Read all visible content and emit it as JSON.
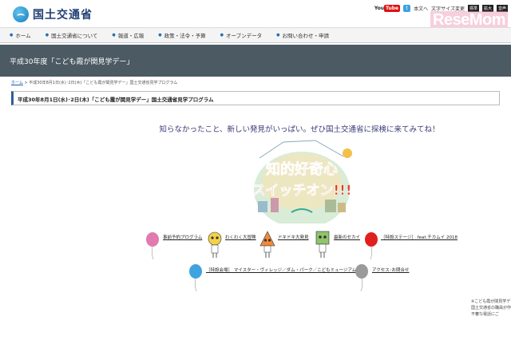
{
  "header": {
    "site_name": "国土交通省",
    "youtube_pre": "You",
    "youtube_label": "Tube",
    "twitter_label": "t",
    "main_text_link": "本文へ",
    "font_size_label": "文字サイズ変更",
    "font_std_label": "標準",
    "font_large_label": "拡大",
    "extra_btn_label": "音声",
    "watermark": "ReseMom"
  },
  "nav": {
    "items": [
      "ホーム",
      "国土交通省について",
      "報道・広報",
      "政策・法令・予算",
      "オープンデータ",
      "お問い合わせ・申請"
    ]
  },
  "banner": {
    "title": "平成30年度「こども霞が関見学デー」"
  },
  "breadcrumb": {
    "home": "ホーム",
    "rest": " > 平成30年8月1日(水)･2日(木)「こども霞が関見学デー」国土交通省見学プログラム"
  },
  "page_title": "平成30年8月1日(水)･2日(木)「こども霞が関見学デー」国土交通省見学プログラム",
  "intro": "知らなかったこと、新しい発見がいっぱい。ぜひ国土交通省に探検に来てみてね！",
  "hero": {
    "line1": "知的好奇心",
    "line2": "スイッチオン!!!"
  },
  "links": {
    "l1": "事前予約プログラム",
    "l2": "わくわく大冒険",
    "l3": "ドキドキ大発見",
    "l4": "最新のセカイ",
    "l5": "［特設ステージ］ feat.チカムイ 2018",
    "l6": "［特設会場］ マイスター・ヴィレッジ／ダム・パーク／こどもミュージアム",
    "l7": "アクセス･お問合せ"
  },
  "note": {
    "line1": "※こども霞が関見学デー",
    "line2": "国土交通省の職員が作",
    "line3": "不審な電話にご"
  },
  "colors": {
    "banner_bg": "#4b5a63",
    "brand_blue": "#1f3f72",
    "hero_red": "#e23a2a"
  }
}
